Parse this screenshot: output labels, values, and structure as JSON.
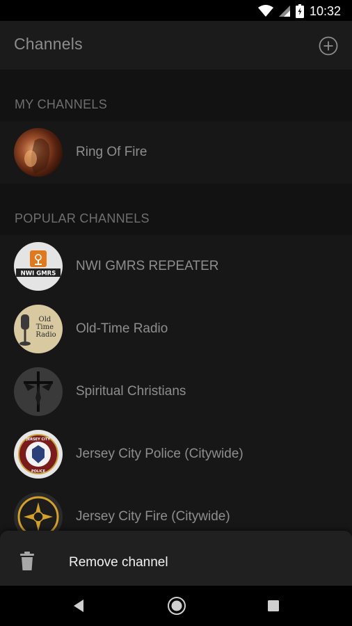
{
  "status_bar": {
    "time": "10:32",
    "icons": [
      "wifi-icon",
      "signal-icon",
      "battery-icon"
    ]
  },
  "app_bar": {
    "title": "Channels",
    "add_icon": "add-circle-icon"
  },
  "sections": {
    "my_channels": {
      "header": "MY CHANNELS",
      "items": [
        {
          "label": "Ring Of Fire",
          "avatar": "ring-of-fire-avatar"
        }
      ]
    },
    "popular_channels": {
      "header": "POPULAR CHANNELS",
      "items": [
        {
          "label": "NWI GMRS REPEATER",
          "avatar": "nwi-gmrs-logo",
          "avatar_text": "NWI GMRS"
        },
        {
          "label": "Old-Time Radio",
          "avatar": "old-time-radio-logo",
          "avatar_text": "Old Time Radio"
        },
        {
          "label": "Spiritual Christians",
          "avatar": "crucifix-avatar"
        },
        {
          "label": "Jersey City Police (Citywide)",
          "avatar": "jersey-city-police-badge",
          "avatar_text": "JERSEY CITY POLICE"
        },
        {
          "label": "Jersey City Fire (Citywide)",
          "avatar": "jersey-city-fire-badge"
        }
      ]
    }
  },
  "bottom_sheet": {
    "action_label": "Remove channel",
    "icon": "trash-icon"
  },
  "nav_bar": {
    "buttons": [
      "back-icon",
      "home-icon",
      "recents-icon"
    ]
  },
  "colors": {
    "background": "#121212",
    "app_bar": "#1b1b1b",
    "list_bg": "#171717",
    "sheet_bg": "#202020",
    "text_dim": "#8e8e8e",
    "section_header": "#6f6f6f"
  }
}
